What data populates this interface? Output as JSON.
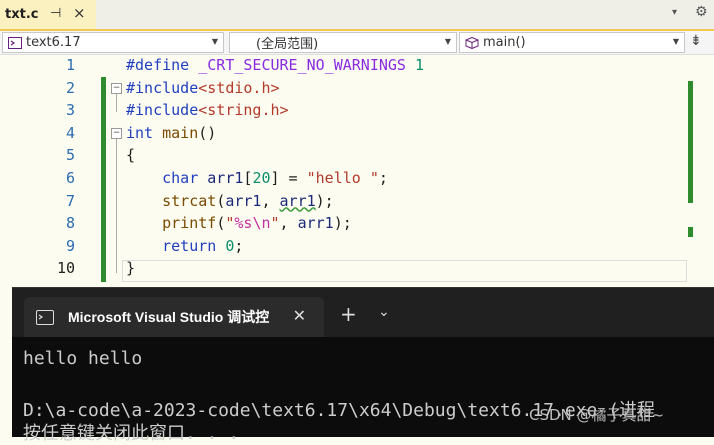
{
  "tab": {
    "title": "txt.c",
    "pin_icon": "pin-icon",
    "close_glyph": "×"
  },
  "toolbar_right": {
    "dropdown_glyph": "▾",
    "settings_glyph": "⚙"
  },
  "navbar": {
    "project": "text6.17",
    "scope": "(全局范围)",
    "function": "main()",
    "split_glyph": "⇟"
  },
  "editor": {
    "line_numbers": [
      "1",
      "2",
      "3",
      "4",
      "5",
      "6",
      "7",
      "8",
      "9",
      "10"
    ],
    "lines": [
      [
        {
          "t": "#define ",
          "c": "kw"
        },
        {
          "t": "_CRT_SECURE_NO_WARNINGS ",
          "c": "macro"
        },
        {
          "t": "1",
          "c": "num"
        }
      ],
      [
        {
          "t": "#include",
          "c": "kw"
        },
        {
          "t": "<stdio.h>",
          "c": "hdr"
        }
      ],
      [
        {
          "t": "#include",
          "c": "kw"
        },
        {
          "t": "<string.h>",
          "c": "hdr"
        }
      ],
      [
        {
          "t": "int ",
          "c": "kw"
        },
        {
          "t": "main",
          "c": "fn"
        },
        {
          "t": "()",
          "c": ""
        }
      ],
      [
        {
          "t": "{",
          "c": ""
        }
      ],
      [
        {
          "t": "    ",
          "c": ""
        },
        {
          "t": "char ",
          "c": "kw"
        },
        {
          "t": "arr1",
          "c": "var"
        },
        {
          "t": "[",
          "c": ""
        },
        {
          "t": "20",
          "c": "num"
        },
        {
          "t": "] = ",
          "c": ""
        },
        {
          "t": "\"hello \"",
          "c": "str"
        },
        {
          "t": ";",
          "c": ""
        }
      ],
      [
        {
          "t": "    ",
          "c": ""
        },
        {
          "t": "strcat",
          "c": "fn"
        },
        {
          "t": "(",
          "c": ""
        },
        {
          "t": "arr1",
          "c": "var"
        },
        {
          "t": ", ",
          "c": ""
        },
        {
          "t": "arr1",
          "c": "var squig"
        },
        {
          "t": ");",
          "c": ""
        }
      ],
      [
        {
          "t": "    ",
          "c": ""
        },
        {
          "t": "printf",
          "c": "fn"
        },
        {
          "t": "(",
          "c": ""
        },
        {
          "t": "\"",
          "c": "str"
        },
        {
          "t": "%s",
          "c": "esc"
        },
        {
          "t": "\\n",
          "c": "esc"
        },
        {
          "t": "\"",
          "c": "str"
        },
        {
          "t": ", ",
          "c": ""
        },
        {
          "t": "arr1",
          "c": "var"
        },
        {
          "t": ");",
          "c": ""
        }
      ],
      [
        {
          "t": "    ",
          "c": ""
        },
        {
          "t": "return ",
          "c": "kw"
        },
        {
          "t": "0",
          "c": "num"
        },
        {
          "t": ";",
          "c": ""
        }
      ],
      [
        {
          "t": "}",
          "c": ""
        }
      ]
    ]
  },
  "console": {
    "tab_title": "Microsoft Visual Studio 调试控",
    "close_glyph": "✕",
    "plus_glyph": "+",
    "chevron_glyph": "⌄",
    "output_lines": [
      "hello hello",
      "",
      "D:\\a-code\\a-2023-code\\text6.17\\x64\\Debug\\text6.17.exe (进程",
      "按任意键关闭此窗口. . ."
    ]
  },
  "watermark": "CSDN @橘子真甜~",
  "colors": {
    "accent_tab": "#fbf0c0",
    "change_bar": "#2e8b2e",
    "console_bg": "#0c0c0c"
  }
}
